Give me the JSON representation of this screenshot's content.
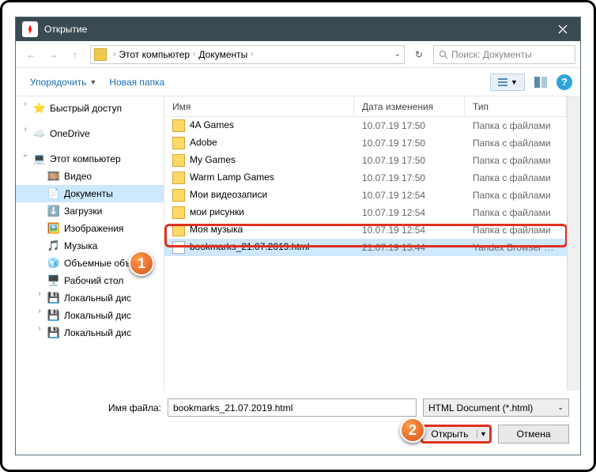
{
  "title": "Открытие",
  "breadcrumb": {
    "item1": "Этот компьютер",
    "item2": "Документы"
  },
  "search": {
    "placeholder": "Поиск: Документы"
  },
  "toolbar": {
    "organize": "Упорядочить",
    "newfolder": "Новая папка"
  },
  "sidebar": {
    "quick": "Быстрый доступ",
    "onedrive": "OneDrive",
    "pc": "Этот компьютер",
    "video": "Видео",
    "docs": "Документы",
    "downloads": "Загрузки",
    "images": "Изображения",
    "music": "Музыка",
    "desktop3d": "Объемные объ",
    "desktop": "Рабочий стол",
    "disk1": "Локальный дис",
    "disk2": "Локальный дис",
    "disk3": "Локальный дис"
  },
  "columns": {
    "name": "Имя",
    "date": "Дата изменения",
    "type": "Тип"
  },
  "files": [
    {
      "name": "4A Games",
      "date": "10.07.19 17:50",
      "type": "Папка с файлами",
      "kind": "folder"
    },
    {
      "name": "Adobe",
      "date": "10.07.19 17:50",
      "type": "Папка с файлами",
      "kind": "folder"
    },
    {
      "name": "My Games",
      "date": "10.07.19 17:50",
      "type": "Папка с файлами",
      "kind": "folder"
    },
    {
      "name": "Warm Lamp Games",
      "date": "10.07.19 17:50",
      "type": "Папка с файлами",
      "kind": "folder"
    },
    {
      "name": "Мои видеозаписи",
      "date": "10.07.19 12:54",
      "type": "Папка с файлами",
      "kind": "folder"
    },
    {
      "name": "мои рисунки",
      "date": "10.07.19 12:54",
      "type": "Папка с файлами",
      "kind": "folder"
    },
    {
      "name": "Моя музыка",
      "date": "10.07.19 12:54",
      "type": "Папка с файлами",
      "kind": "folder"
    },
    {
      "name": "bookmarks_21.07.2019.html",
      "date": "21.07.19 15:44",
      "type": "Yandex Browser H...",
      "kind": "file",
      "selected": true
    }
  ],
  "filename": {
    "label": "Имя файла:",
    "value": "bookmarks_21.07.2019.html"
  },
  "filter": "HTML Document (*.html)",
  "buttons": {
    "open": "Открыть",
    "cancel": "Отмена"
  },
  "callouts": {
    "one": "1",
    "two": "2"
  }
}
